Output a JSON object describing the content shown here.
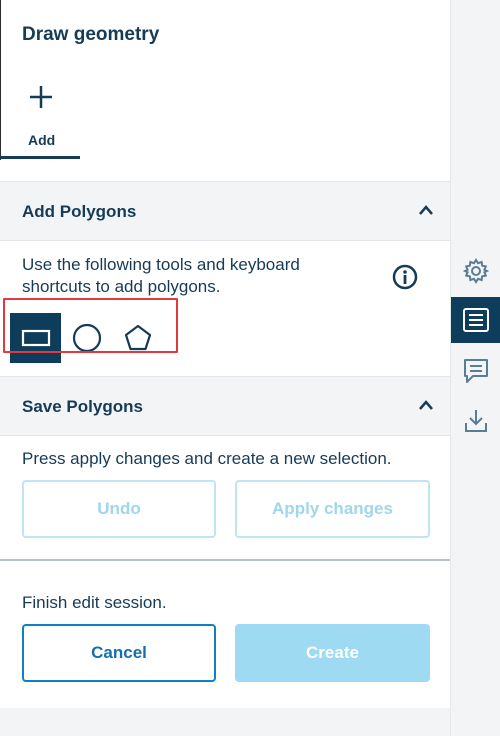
{
  "header": {
    "title": "Draw geometry"
  },
  "add_tab": {
    "label": "Add",
    "icon": "plus-icon"
  },
  "add_polygons": {
    "title": "Add Polygons",
    "description_line1": "Use the following tools and keyboard",
    "description_line2": "shortcuts to add polygons.",
    "tools": [
      {
        "name": "rectangle-tool",
        "icon": "rectangle-icon",
        "active": true
      },
      {
        "name": "circle-tool",
        "icon": "circle-icon",
        "active": false
      },
      {
        "name": "polygon-tool",
        "icon": "pentagon-icon",
        "active": false
      }
    ]
  },
  "save_polygons": {
    "title": "Save Polygons",
    "description": "Press apply changes and create a new selection.",
    "undo_label": "Undo",
    "apply_label": "Apply changes"
  },
  "finish": {
    "description": "Finish edit session.",
    "cancel_label": "Cancel",
    "create_label": "Create"
  },
  "sidebar": {
    "items": [
      {
        "icon": "gear-icon",
        "active": false
      },
      {
        "icon": "list-icon",
        "active": true
      },
      {
        "icon": "comment-icon",
        "active": false
      },
      {
        "icon": "download-icon",
        "active": false
      }
    ]
  },
  "colors": {
    "primary": "#0e3d5c",
    "accent": "#1180c0",
    "disabled": "#9edaf2",
    "highlight": "#e1393e"
  }
}
